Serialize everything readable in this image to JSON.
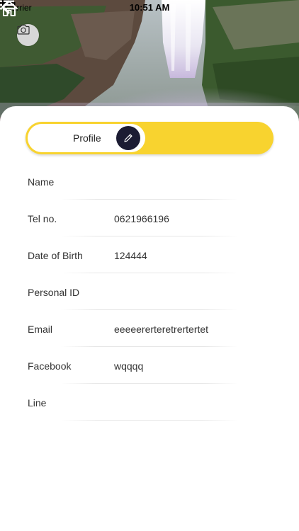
{
  "status_bar": {
    "carrier": "Carrier",
    "time": "10:51 AM"
  },
  "header": {
    "camera_icon": "camera-icon",
    "home_icon": "home-icon",
    "back_icon": "chevron-left-icon",
    "menu_icon": "list-icon"
  },
  "toggle": {
    "active_label": "Profile",
    "edit_icon": "pencil-icon",
    "accent_color": "#f8d32f",
    "edit_button_color": "#1c1c33"
  },
  "fields": [
    {
      "label": "Name",
      "value": ""
    },
    {
      "label": "Tel no.",
      "value": "0621966196"
    },
    {
      "label": "Date of Birth",
      "value": "124444"
    },
    {
      "label": "Personal ID",
      "value": ""
    },
    {
      "label": "Email",
      "value": "eeeeererteretrertertet"
    },
    {
      "label": "Facebook",
      "value": "wqqqq"
    },
    {
      "label": "Line",
      "value": ""
    }
  ]
}
